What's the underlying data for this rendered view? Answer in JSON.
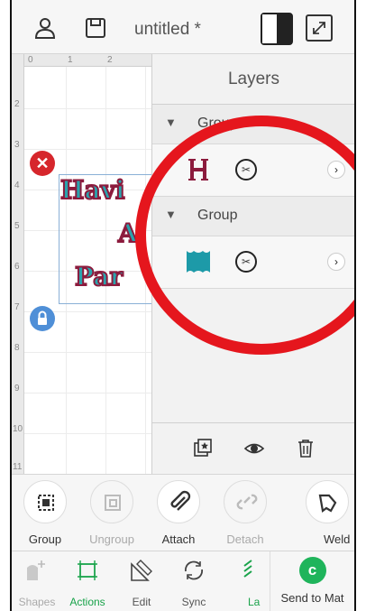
{
  "topbar": {
    "title": "untitled *",
    "icons": [
      "account-icon",
      "save-icon",
      "split-view-icon",
      "expand-icon"
    ]
  },
  "ruler": {
    "top": [
      "0",
      "1",
      "2"
    ],
    "left": [
      "2",
      "3",
      "4",
      "5",
      "6",
      "7",
      "8",
      "9",
      "10",
      "11"
    ]
  },
  "design": {
    "lines": [
      "Havi",
      "A",
      "Par"
    ]
  },
  "layers": {
    "title": "Layers",
    "groups": [
      {
        "label": "Group",
        "item_color": "#8c1b3d",
        "item_glyph": "H"
      },
      {
        "label": "Group",
        "item_color": "#1d9aa8",
        "item_glyph": ""
      }
    ],
    "toolbar_icons": [
      "duplicate-icon",
      "visibility-eye-icon",
      "trash-icon"
    ]
  },
  "actions": [
    {
      "label": "Group",
      "icon": "group-icon",
      "disabled": false
    },
    {
      "label": "Ungroup",
      "icon": "ungroup-icon",
      "disabled": true
    },
    {
      "label": "Attach",
      "icon": "paperclip-icon",
      "disabled": false
    },
    {
      "label": "Detach",
      "icon": "detach-icon",
      "disabled": true
    },
    {
      "label": "Weld",
      "icon": "weld-icon",
      "disabled": false
    }
  ],
  "bottom_nav": [
    {
      "label": "Shapes",
      "icon": "shapes-icon",
      "state": "faded"
    },
    {
      "label": "Actions",
      "icon": "actions-icon",
      "state": "active"
    },
    {
      "label": "Edit",
      "icon": "edit-icon",
      "state": "normal"
    },
    {
      "label": "Sync",
      "icon": "sync-icon",
      "state": "normal"
    },
    {
      "label": "La",
      "icon": "layers-icon",
      "state": "active"
    }
  ],
  "send": {
    "label": "Send to Mat",
    "glyph": "c"
  },
  "colors": {
    "accent_green": "#19a34a",
    "delete_red": "#d6262c",
    "lock_blue": "#4f8fd7",
    "annotation_red": "#e5161d"
  }
}
